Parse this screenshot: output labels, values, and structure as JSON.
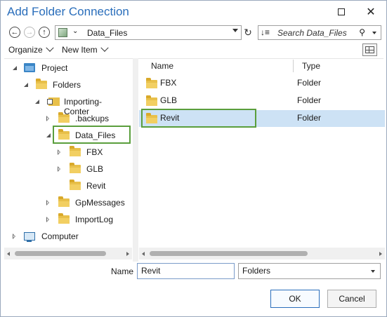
{
  "window": {
    "title": "Add Folder Connection"
  },
  "toolbar": {
    "address_path": "Data_Files",
    "search_placeholder": "Search Data_Files"
  },
  "menubar": {
    "organize_label": "Organize",
    "new_item_label": "New Item"
  },
  "tree": {
    "items": [
      {
        "label": "Project",
        "icon": "project-icon",
        "expander": "open"
      },
      {
        "label": "Folders",
        "icon": "folder-icon",
        "expander": "open"
      },
      {
        "label": "Importing-Conter",
        "icon": "home-folder-icon",
        "expander": "open"
      },
      {
        "label": ".backups",
        "icon": "folder-icon",
        "expander": "closed"
      },
      {
        "label": "Data_Files",
        "icon": "folder-icon",
        "expander": "open",
        "selected": true
      },
      {
        "label": "FBX",
        "icon": "folder-icon",
        "expander": "closed"
      },
      {
        "label": "GLB",
        "icon": "folder-icon",
        "expander": "closed"
      },
      {
        "label": "Revit",
        "icon": "folder-icon",
        "expander": "none"
      },
      {
        "label": "GpMessages",
        "icon": "folder-icon",
        "expander": "closed"
      },
      {
        "label": "ImportLog",
        "icon": "folder-icon",
        "expander": "closed"
      },
      {
        "label": "Computer",
        "icon": "computer-icon",
        "expander": "closed"
      }
    ]
  },
  "list": {
    "columns": [
      "Name",
      "Type"
    ],
    "rows": [
      {
        "name": "FBX",
        "type": "Folder"
      },
      {
        "name": "GLB",
        "type": "Folder"
      },
      {
        "name": "Revit",
        "type": "Folder",
        "selected": true
      }
    ]
  },
  "footer": {
    "name_label": "Name",
    "name_value": "Revit",
    "filter_value": "Folders",
    "ok_label": "OK",
    "cancel_label": "Cancel"
  },
  "colors": {
    "title": "#2a6ebb",
    "highlight_border": "#5a9e3c",
    "selection": "#cde2f5"
  }
}
